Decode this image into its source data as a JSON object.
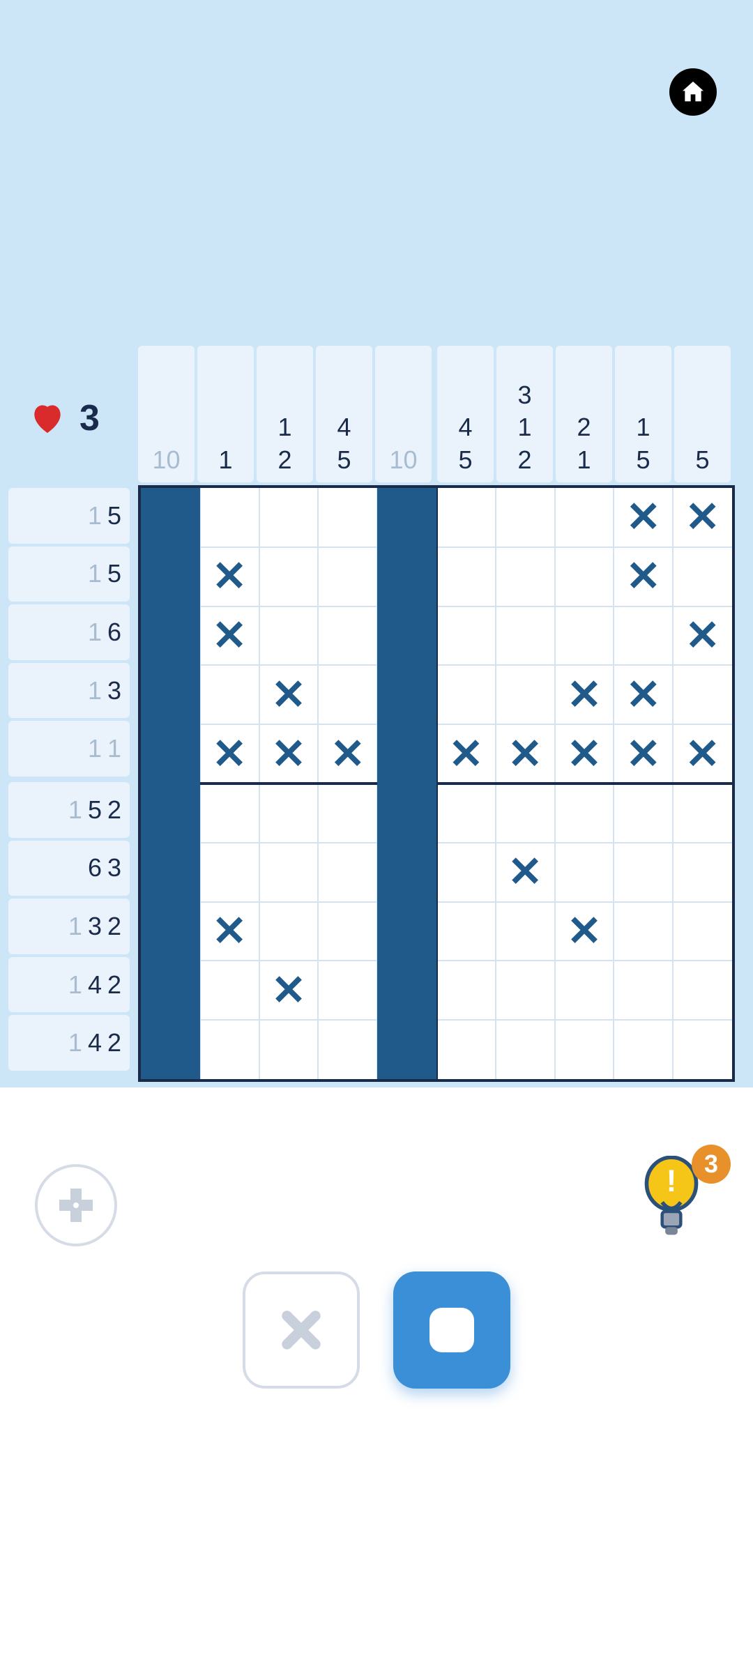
{
  "lives": 3,
  "hints": 3,
  "col_clues": [
    {
      "nums": [
        "10"
      ],
      "faded": [
        true
      ]
    },
    {
      "nums": [
        "1"
      ],
      "faded": [
        false
      ]
    },
    {
      "nums": [
        "1",
        "2"
      ],
      "faded": [
        false,
        false
      ]
    },
    {
      "nums": [
        "4",
        "5"
      ],
      "faded": [
        false,
        false
      ]
    },
    {
      "nums": [
        "10"
      ],
      "faded": [
        true
      ]
    },
    {
      "nums": [
        "4",
        "5"
      ],
      "faded": [
        false,
        false
      ]
    },
    {
      "nums": [
        "3",
        "1",
        "2"
      ],
      "faded": [
        false,
        false,
        false
      ]
    },
    {
      "nums": [
        "2",
        "1"
      ],
      "faded": [
        false,
        false
      ]
    },
    {
      "nums": [
        "1",
        "5"
      ],
      "faded": [
        false,
        false
      ]
    },
    {
      "nums": [
        "5"
      ],
      "faded": [
        false
      ]
    }
  ],
  "row_clues": [
    {
      "nums": [
        "1",
        "5"
      ],
      "faded": [
        true,
        false
      ]
    },
    {
      "nums": [
        "1",
        "5"
      ],
      "faded": [
        true,
        false
      ]
    },
    {
      "nums": [
        "1",
        "6"
      ],
      "faded": [
        true,
        false
      ]
    },
    {
      "nums": [
        "1",
        "3"
      ],
      "faded": [
        true,
        false
      ]
    },
    {
      "nums": [
        "1",
        "1"
      ],
      "faded": [
        true,
        true
      ]
    },
    {
      "nums": [
        "1",
        "5",
        "2"
      ],
      "faded": [
        true,
        false,
        false
      ]
    },
    {
      "nums": [
        "6",
        "3"
      ],
      "faded": [
        false,
        false
      ]
    },
    {
      "nums": [
        "1",
        "3",
        "2"
      ],
      "faded": [
        true,
        false,
        false
      ]
    },
    {
      "nums": [
        "1",
        "4",
        "2"
      ],
      "faded": [
        true,
        false,
        false
      ]
    },
    {
      "nums": [
        "1",
        "4",
        "2"
      ],
      "faded": [
        true,
        false,
        false
      ]
    }
  ],
  "grid": [
    [
      "F",
      "",
      "",
      "",
      "F",
      "",
      "",
      "",
      "X",
      "X"
    ],
    [
      "F",
      "X",
      "",
      "",
      "F",
      "",
      "",
      "",
      "X",
      ""
    ],
    [
      "F",
      "X",
      "",
      "",
      "F",
      "",
      "",
      "",
      "",
      "X"
    ],
    [
      "F",
      "",
      "X",
      "",
      "F",
      "",
      "",
      "X",
      "X",
      ""
    ],
    [
      "F",
      "X",
      "X",
      "X",
      "F",
      "X",
      "X",
      "X",
      "X",
      "X"
    ],
    [
      "F",
      "",
      "",
      "",
      "F",
      "",
      "",
      "",
      "",
      ""
    ],
    [
      "F",
      "",
      "",
      "",
      "F",
      "",
      "X",
      "",
      "",
      ""
    ],
    [
      "F",
      "X",
      "",
      "",
      "F",
      "",
      "",
      "X",
      "",
      ""
    ],
    [
      "F",
      "",
      "X",
      "",
      "F",
      "",
      "",
      "",
      "",
      ""
    ],
    [
      "F",
      "",
      "",
      "",
      "F",
      "",
      "",
      "",
      "",
      ""
    ]
  ],
  "icons": {
    "home": "home-icon",
    "heart": "heart-icon",
    "dpad": "dpad-icon",
    "bulb": "bulb-icon"
  },
  "colors": {
    "bg_game": "#cce6f8",
    "clue_bg": "#eaf3fb",
    "clue_text": "#1a2b4a",
    "clue_faded": "#a8bcd1",
    "fill": "#1f5a8a",
    "accent_blue": "#3b8fd6",
    "badge": "#e8912b",
    "heart": "#d92b2b"
  }
}
